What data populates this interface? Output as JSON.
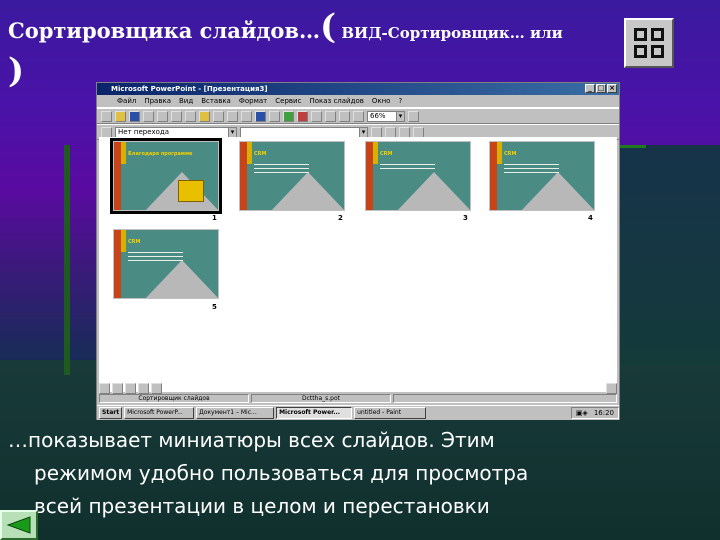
{
  "slide": {
    "title_part1": "Сортировщика слайдов…",
    "title_paren_open": "(",
    "title_part2": " ВИД-Сортировщик… или",
    "title_paren_close": ")",
    "caption_line1": "…показывает миниатюры всех слайдов. Этим",
    "caption_line2": "режимом удобно пользоваться для просмотра",
    "caption_line3": "всей презентации в целом и перестановки",
    "view_icon": "slide-sorter-icon",
    "back_icon": "back-arrow-icon",
    "colors": {
      "text": "#ffffff",
      "accent_green": "#1f7a1f",
      "background": "#4a12a8"
    }
  },
  "window": {
    "title": "Microsoft PowerPoint - [Презентация3]",
    "menu": [
      "Файл",
      "Правка",
      "Вид",
      "Вставка",
      "Формат",
      "Сервис",
      "Показ слайдов",
      "Окно",
      "?"
    ],
    "toolbar": {
      "transition": "Нет перехода",
      "zoom": "66%"
    },
    "slides": [
      {
        "number": "1",
        "heading": "Благодаря программе",
        "selected": true
      },
      {
        "number": "2",
        "heading": "CRM"
      },
      {
        "number": "3",
        "heading": "CRM"
      },
      {
        "number": "4",
        "heading": "CRM"
      },
      {
        "number": "5",
        "heading": "CRM"
      }
    ],
    "status": {
      "view": "Сортировщик слайдов",
      "template": "Dcttha_s.pot"
    },
    "taskbar": {
      "start": "Start",
      "tasks": [
        "Microsoft PowerP...",
        "Документ1 – Mic...",
        "Microsoft Power...",
        "untitled - Paint"
      ],
      "active_task": "Microsoft Power...",
      "clock": "16:20"
    }
  }
}
